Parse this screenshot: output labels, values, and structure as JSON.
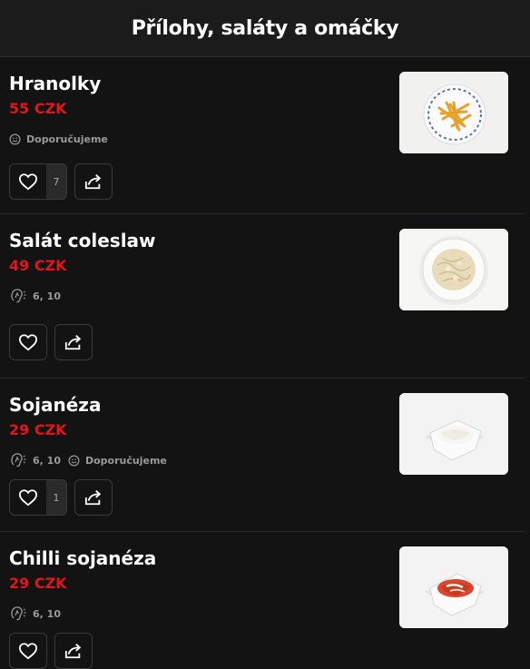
{
  "header": {
    "title": "Přílohy, saláty a omáčky"
  },
  "items": [
    {
      "name": "Hranolky",
      "price": "55 CZK",
      "allergens": "",
      "recommended": "Doporučujeme",
      "likes": "7"
    },
    {
      "name": "Salát coleslaw",
      "price": "49 CZK",
      "allergens": "6, 10",
      "recommended": "",
      "likes": ""
    },
    {
      "name": "Sojanéza",
      "price": "29 CZK",
      "allergens": "6, 10",
      "recommended": "Doporučujeme",
      "likes": "1"
    },
    {
      "name": "Chilli sojanéza",
      "price": "29 CZK",
      "allergens": "6, 10",
      "recommended": "",
      "likes": ""
    }
  ],
  "colors": {
    "price": "#e0161c",
    "background": "#131313"
  },
  "icons": [
    "heart-icon",
    "share-icon",
    "allergen-icon",
    "recommended-icon"
  ]
}
